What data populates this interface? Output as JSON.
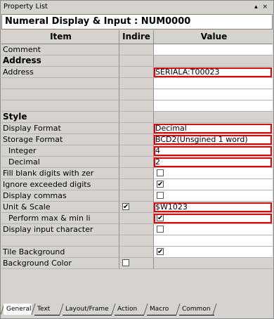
{
  "window": {
    "title": "Property List",
    "controls": "▴ ×"
  },
  "header": {
    "title": "Numeral Display & Input : NUM0000"
  },
  "columns": {
    "item": "Item",
    "indirect": "Indire",
    "value": "Value"
  },
  "rows": [
    {
      "item": "Comment",
      "value": ""
    },
    {
      "item": "Address",
      "section": true
    },
    {
      "item": "Address",
      "value": "SERIALA:T00023",
      "highlight": true
    },
    {
      "item": "",
      "value": ""
    },
    {
      "item": "",
      "value": ""
    },
    {
      "item": "",
      "value": ""
    },
    {
      "item": "Style",
      "section": true
    },
    {
      "item": "Display Format",
      "value": "Decimal",
      "highlight": true
    },
    {
      "item": "Storage Format",
      "value": "BCD2(Unsgined 1 word)",
      "highlight": true
    },
    {
      "item": "Integer",
      "value": "4",
      "highlight": true,
      "indent": true
    },
    {
      "item": "Decimal",
      "value": "2",
      "highlight": true,
      "indent": true
    },
    {
      "item": "Fill blank digits with zer",
      "check": false
    },
    {
      "item": "Ignore exceeded digits",
      "check": true
    },
    {
      "item": "Display commas",
      "check": false
    },
    {
      "item": "Unit & Scale",
      "value": "$W1023",
      "indirectCheck": true,
      "highlight": true
    },
    {
      "item": "Perform max & min li",
      "check": true,
      "highlight": true,
      "indent": true
    },
    {
      "item": "Display input character",
      "check": false
    },
    {
      "item": "",
      "value": ""
    },
    {
      "item": "Tile Background",
      "check": true
    },
    {
      "item": "Background Color",
      "indirectCheck": false,
      "greyValue": true
    }
  ],
  "tabs": [
    "General",
    "Text",
    "Layout/Frame",
    "Action",
    "Macro",
    "Common"
  ]
}
